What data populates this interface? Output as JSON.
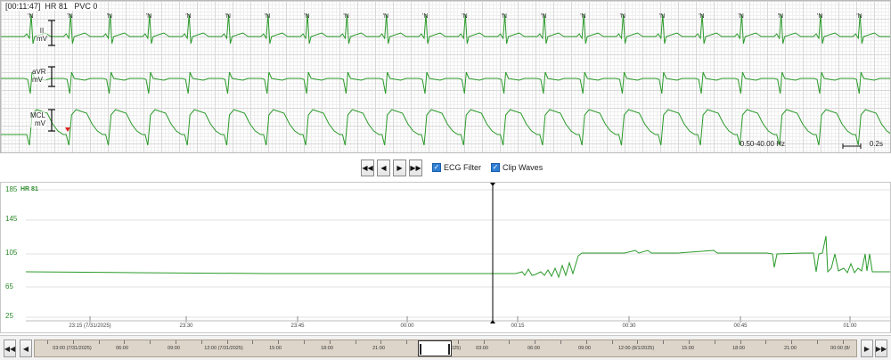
{
  "ecg": {
    "header": "[00:11:47]  HR 81   PVC 0",
    "beat_marker": "'N",
    "leads": [
      {
        "name": "II",
        "unit": "mV"
      },
      {
        "name": "aVR",
        "unit": "mV"
      },
      {
        "name": "MCL",
        "unit": "mV"
      }
    ],
    "filter_readout": "0.50-40.00 Hz",
    "time_scale": "0.2s",
    "colors": {
      "trace": "#2a9a2a",
      "grid_major": "#d8d8d8",
      "grid_minor": "#efefef",
      "pvc_marker": "#e02020"
    }
  },
  "controls": {
    "buttons": [
      {
        "name": "first-page-button",
        "icon": "double-left-arrow",
        "glyph": "◀◀"
      },
      {
        "name": "previous-page-button",
        "icon": "left-arrow",
        "glyph": "◀"
      },
      {
        "name": "next-page-button",
        "icon": "right-arrow",
        "glyph": "▶"
      },
      {
        "name": "last-page-button",
        "icon": "double-right-arrow",
        "glyph": "▶▶"
      }
    ],
    "ecg_filter_label": "ECG Filter",
    "ecg_filter_checked": true,
    "clip_waves_label": "Clip Waves",
    "clip_waves_checked": true
  },
  "trend": {
    "hr_label": "HR 81",
    "y_ticks": [
      "185",
      "145",
      "105",
      "65",
      "25"
    ],
    "x_ticks": [
      "23:15 (7/31/2025)",
      "23:30",
      "23:45",
      "00:00",
      "00:15",
      "00:30",
      "00:45",
      "01:00"
    ],
    "colors": {
      "line": "#2a9a2a",
      "grid": "#e0e0e0",
      "cursor": "#000000"
    }
  },
  "scrollbar": {
    "labels": [
      "03:00 (7/31/2025)",
      "06:00",
      "09:00",
      "12:00 (7/31/2025)",
      "15:00",
      "18:00",
      "21:00",
      "00:00 (8/1/2025)",
      "03:00",
      "06:00",
      "09:00",
      "12:00 (8/1/2025)",
      "15:00",
      "18:00",
      "21:00",
      "00:00 (8/"
    ]
  }
}
